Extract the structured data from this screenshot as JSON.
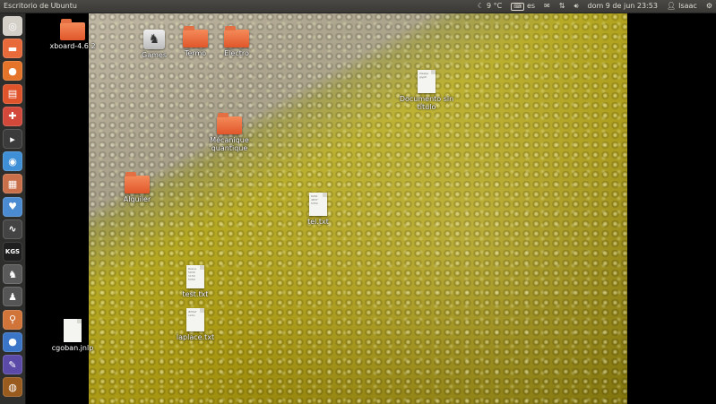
{
  "topbar": {
    "title": "Escritorio de Ubuntu",
    "weather": "9 °C",
    "keyboard": "es",
    "clock": "dom 9 de jun 23:53",
    "user": "Isaac"
  },
  "launcher": {
    "items": [
      {
        "name": "dash-home",
        "glyph": "◎",
        "color": "#d4d0c8"
      },
      {
        "name": "files",
        "glyph": "▬",
        "color": "#e86a3a"
      },
      {
        "name": "firefox",
        "glyph": "●",
        "color": "#e4742a"
      },
      {
        "name": "libreoffice",
        "glyph": "▤",
        "color": "#e0542b"
      },
      {
        "name": "software-center",
        "glyph": "✚",
        "color": "#d2483a"
      },
      {
        "name": "terminal",
        "glyph": "▸",
        "color": "#3b3b3b"
      },
      {
        "name": "chromium",
        "glyph": "◉",
        "color": "#3f8fd6"
      },
      {
        "name": "app-8",
        "glyph": "▦",
        "color": "#c9704a"
      },
      {
        "name": "app-9",
        "glyph": "♥",
        "color": "#4a8bd1"
      },
      {
        "name": "system-monitor",
        "glyph": "∿",
        "color": "#444"
      },
      {
        "name": "kgs",
        "glyph": "KGS",
        "color": "#1f1f1f"
      },
      {
        "name": "chess-knight",
        "glyph": "♞",
        "color": "#5a5a5a"
      },
      {
        "name": "chess-pawn",
        "glyph": "♟",
        "color": "#555"
      },
      {
        "name": "search-app",
        "glyph": "⚲",
        "color": "#d0743a"
      },
      {
        "name": "app-15",
        "glyph": "●",
        "color": "#3b75c8"
      },
      {
        "name": "app-16",
        "glyph": "✎",
        "color": "#5c4aa8"
      },
      {
        "name": "app-17",
        "glyph": "◍",
        "color": "#9a5b1e"
      }
    ]
  },
  "desktop": {
    "icons": [
      {
        "name": "xboard",
        "label": "xboard-4.6.2",
        "kind": "folder"
      },
      {
        "name": "games",
        "label": "Games",
        "kind": "games"
      },
      {
        "name": "termo",
        "label": "Termo",
        "kind": "folder"
      },
      {
        "name": "electro",
        "label": "Electro",
        "kind": "folder"
      },
      {
        "name": "documento",
        "label": "Documento sin título",
        "kind": "doc",
        "doc_text": "Plaatje glyph"
      },
      {
        "name": "mecanique",
        "label": "Mécanique quantique",
        "kind": "folder"
      },
      {
        "name": "alquiler",
        "label": "Alquiler",
        "kind": "folder"
      },
      {
        "name": "tel",
        "label": "tel.txt",
        "kind": "doc",
        "doc_text": "6261 4837 5354"
      },
      {
        "name": "test",
        "label": "test.txt",
        "kind": "doc",
        "doc_text": "Resue 5030 1150 5350"
      },
      {
        "name": "laplace",
        "label": "laplace.txt",
        "kind": "doc",
        "doc_text": "#ifdef radio"
      },
      {
        "name": "cgoban",
        "label": "cgoban.jnlp",
        "kind": "doc",
        "doc_text": ""
      }
    ]
  }
}
